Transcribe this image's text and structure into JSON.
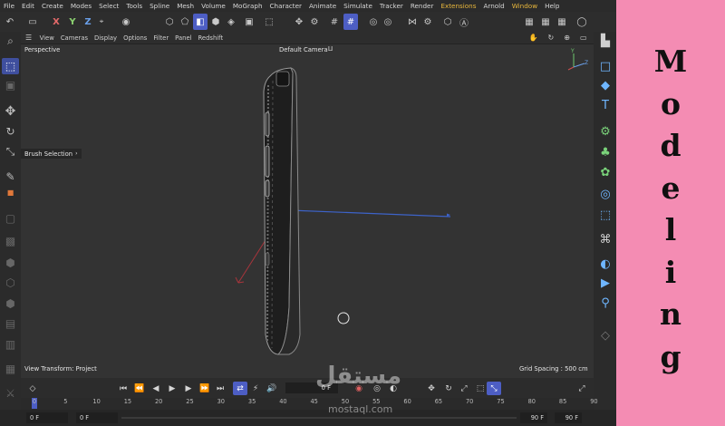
{
  "menu": [
    "File",
    "Edit",
    "Create",
    "Modes",
    "Select",
    "Tools",
    "Spline",
    "Mesh",
    "Volume",
    "MoGraph",
    "Character",
    "Animate",
    "Simulate",
    "Tracker",
    "Render",
    "Extensions",
    "Arnold",
    "Window",
    "Help"
  ],
  "toolbar": {
    "axis_x": "X",
    "axis_y": "Y",
    "axis_z": "Z"
  },
  "viewport_menu": [
    "Cameras",
    "Display",
    "Options",
    "Filter",
    "Panel",
    "Redshift"
  ],
  "viewport_menu_first": "View",
  "viewport": {
    "name": "Perspective",
    "camera": "Default Camera",
    "camera_glyph": "⨿",
    "brush_selection": "Brush Selection",
    "view_transform": "View Transform: Project",
    "grid_spacing": "Grid Spacing : 500 cm"
  },
  "axis_gizmo": {
    "y": "Y",
    "z": "Z"
  },
  "timeline": {
    "current_frame": "0 F"
  },
  "ruler_ticks": [
    "0",
    "5",
    "10",
    "15",
    "20",
    "25",
    "30",
    "35",
    "40",
    "45",
    "50",
    "55",
    "60",
    "65",
    "70",
    "75",
    "80",
    "85",
    "90"
  ],
  "range": {
    "start": "0 F",
    "preview_start": "0 F",
    "preview_end": "90 F",
    "end": "90 F"
  },
  "side_banner": {
    "letters": [
      "M",
      "o",
      "d",
      "e",
      "l",
      "i",
      "n",
      "g"
    ]
  },
  "watermark": {
    "main": "مستقل",
    "sub": "mostaql.com"
  },
  "icons": {
    "search": "search-icon",
    "select": "select-icon",
    "move": "move-icon",
    "rotate": "rotate-icon",
    "scale": "scale-icon"
  }
}
